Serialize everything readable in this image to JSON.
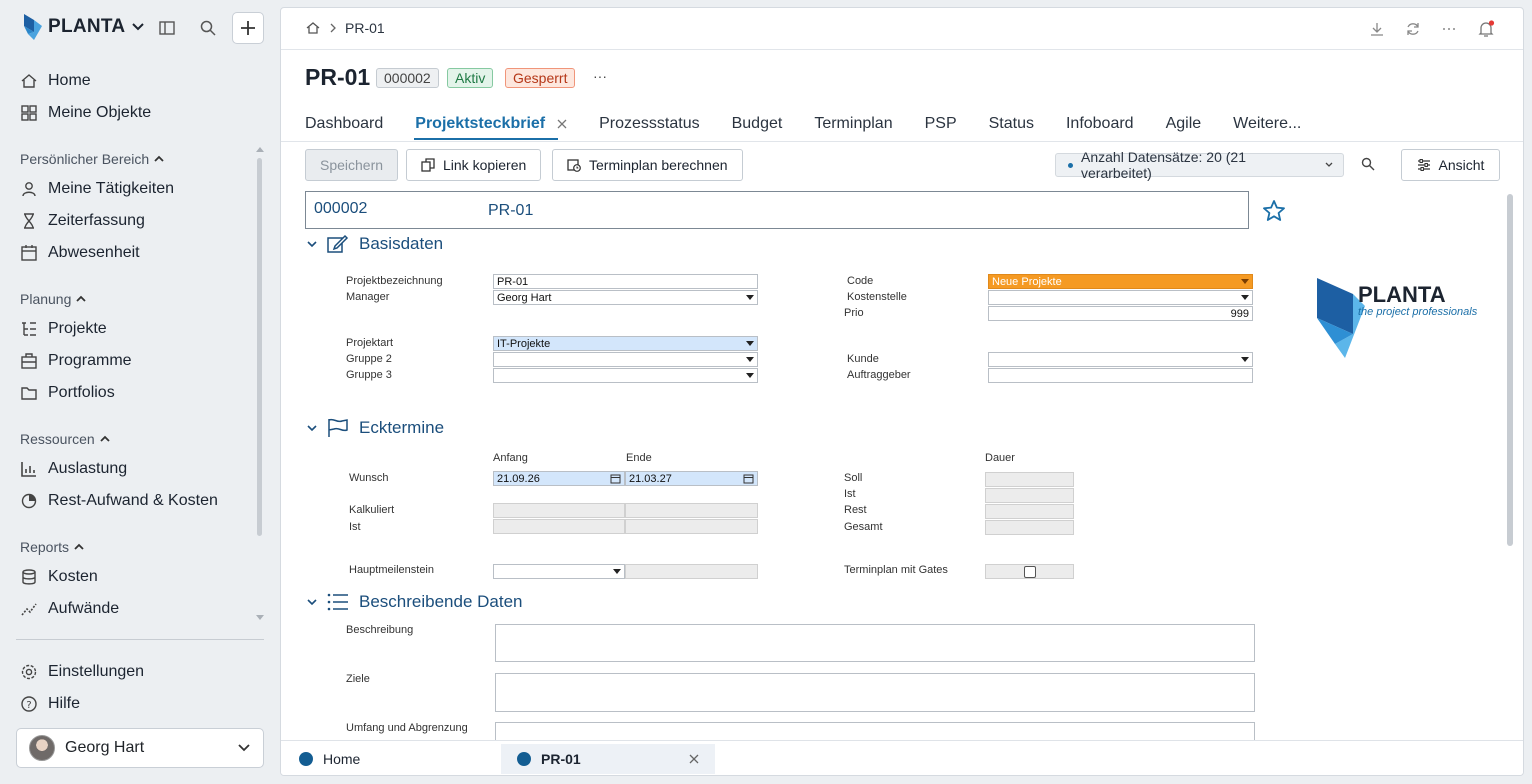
{
  "brand": {
    "name": "PLANTA"
  },
  "sidebar": {
    "main_items": [
      {
        "label": "Home",
        "icon": "home-icon"
      },
      {
        "label": "Meine Objekte",
        "icon": "grid-icon"
      }
    ],
    "sections": [
      {
        "title": "Persönlicher Bereich",
        "items": [
          {
            "label": "Meine Tätigkeiten",
            "icon": "person-icon"
          },
          {
            "label": "Zeiterfassung",
            "icon": "hourglass-icon"
          },
          {
            "label": "Abwesenheit",
            "icon": "calendar-icon"
          }
        ]
      },
      {
        "title": "Planung",
        "items": [
          {
            "label": "Projekte",
            "icon": "list-tree-icon"
          },
          {
            "label": "Programme",
            "icon": "briefcase-icon"
          },
          {
            "label": "Portfolios",
            "icon": "folder-icon"
          }
        ]
      },
      {
        "title": "Ressourcen",
        "items": [
          {
            "label": "Auslastung",
            "icon": "bar-chart-icon"
          },
          {
            "label": "Rest-Aufwand & Kosten",
            "icon": "pie-chart-icon"
          }
        ]
      },
      {
        "title": "Reports",
        "items": [
          {
            "label": "Kosten",
            "icon": "coins-icon"
          },
          {
            "label": "Aufwände",
            "icon": "trend-icon"
          }
        ]
      }
    ],
    "footer_items": [
      {
        "label": "Einstellungen",
        "icon": "gear-icon"
      },
      {
        "label": "Hilfe",
        "icon": "help-icon"
      }
    ],
    "user": {
      "name": "Georg Hart"
    }
  },
  "breadcrumb": {
    "current": "PR-01"
  },
  "header": {
    "title": "PR-01",
    "badge_id": "000002",
    "badge_status": "Aktiv",
    "badge_lock": "Gesperrt",
    "more": "···"
  },
  "tabs": [
    "Dashboard",
    "Projektsteckbrief",
    "Prozessstatus",
    "Budget",
    "Terminplan",
    "PSP",
    "Status",
    "Infoboard",
    "Agile",
    "Weitere..."
  ],
  "toolbar": {
    "save": "Speichern",
    "copy_link": "Link kopieren",
    "calc": "Terminplan berechnen",
    "records": "Anzahl Datensätze: 20 (21 verarbeitet)",
    "view": "Ansicht"
  },
  "form": {
    "id": "000002",
    "name": "PR-01",
    "basis": {
      "title": "Basisdaten",
      "projektbezeichnung_label": "Projektbezeichnung",
      "projektbezeichnung": "PR-01",
      "manager_label": "Manager",
      "manager": "Georg Hart",
      "projektart_label": "Projektart",
      "projektart": "IT-Projekte",
      "gruppe2_label": "Gruppe 2",
      "gruppe3_label": "Gruppe 3",
      "code_label": "Code",
      "code": "Neue Projekte",
      "kostenstelle_label": "Kostenstelle",
      "prio_label": "Prio",
      "prio": "999",
      "kunde_label": "Kunde",
      "auftraggeber_label": "Auftraggeber"
    },
    "termine": {
      "title": "Ecktermine",
      "anfang_label": "Anfang",
      "ende_label": "Ende",
      "dauer_label": "Dauer",
      "wunsch_label": "Wunsch",
      "wunsch_anfang": "21.09.26",
      "wunsch_ende": "21.03.27",
      "kalkuliert_label": "Kalkuliert",
      "ist_label": "Ist",
      "soll_label": "Soll",
      "rest_label": "Rest",
      "gesamt_label": "Gesamt",
      "hauptmeilenstein_label": "Hauptmeilenstein",
      "gates_label": "Terminplan mit Gates"
    },
    "beschreibung": {
      "title": "Beschreibende Daten",
      "beschreibung_label": "Beschreibung",
      "ziele_label": "Ziele",
      "umfang_label": "Umfang und Abgrenzung"
    }
  },
  "logo": {
    "word": "PLANTA",
    "tagline": "the project professionals"
  },
  "bottom_tabs": [
    {
      "label": "Home"
    },
    {
      "label": "PR-01"
    }
  ],
  "colors": {
    "accent": "#1b6fa8",
    "orange": "#f59a23",
    "active_badge": "#2e8b57",
    "lock_badge": "#c0391b"
  }
}
